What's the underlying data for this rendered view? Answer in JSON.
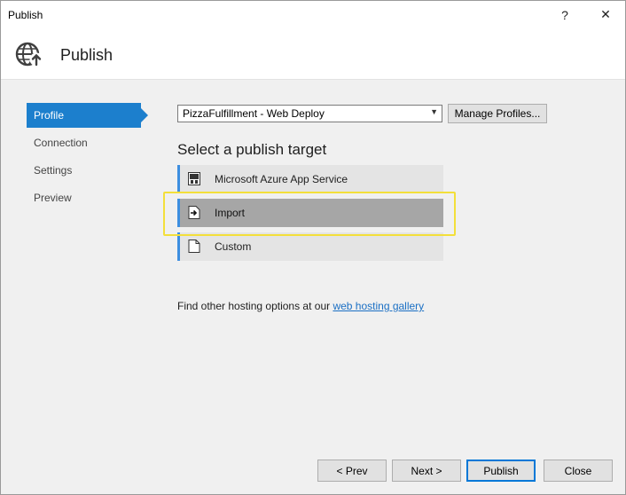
{
  "window": {
    "title": "Publish",
    "help_glyph": "?",
    "close_glyph": "✕"
  },
  "header": {
    "title": "Publish",
    "icon": "globe-publish-icon"
  },
  "nav": {
    "items": [
      {
        "label": "Profile",
        "active": true
      },
      {
        "label": "Connection",
        "active": false
      },
      {
        "label": "Settings",
        "active": false
      },
      {
        "label": "Preview",
        "active": false
      }
    ]
  },
  "profile": {
    "selected": "PizzaFulfillment - Web Deploy",
    "manage_label": "Manage Profiles..."
  },
  "targets": {
    "heading": "Select a publish target",
    "items": [
      {
        "label": "Microsoft Azure App Service",
        "icon": "azure-app-service-icon",
        "selected": false
      },
      {
        "label": "Import",
        "icon": "import-icon",
        "selected": true
      },
      {
        "label": "Custom",
        "icon": "document-icon",
        "selected": false
      }
    ]
  },
  "hosting": {
    "prefix": "Find other hosting options at our",
    "link": "web hosting gallery"
  },
  "footer": {
    "prev": "< Prev",
    "next": "Next >",
    "publish": "Publish",
    "close": "Close"
  },
  "colors": {
    "accent": "#1c7fcd",
    "selection": "#a6a6a6",
    "highlight": "#f3df3a"
  }
}
